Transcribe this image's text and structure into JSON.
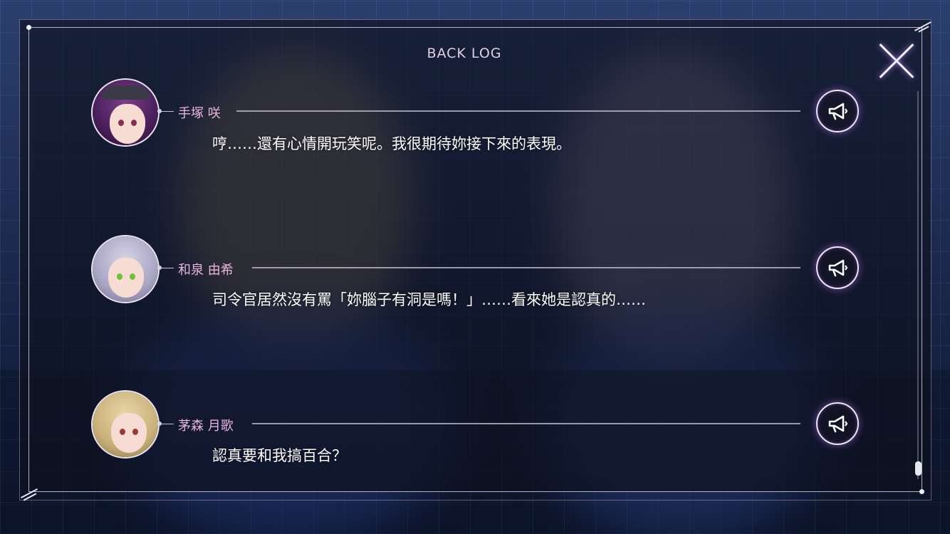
{
  "screen": {
    "title": "BACK LOG"
  },
  "colors": {
    "name_text": "#e7b5e0",
    "message_text": "#ffffff",
    "panel_bg": "#0e101e",
    "glow": "#d278ff"
  },
  "entries": [
    {
      "speaker": "手塚 咲",
      "message": "哼……還有心情開玩笑呢。我很期待妳接下來的表現。",
      "icon": "megaphone-icon"
    },
    {
      "speaker": "和泉 由希",
      "message": "司令官居然沒有罵「妳腦子有洞是嗎！」……看來她是認真的……",
      "icon": "megaphone-icon"
    },
    {
      "speaker": "茅森 月歌",
      "message": "認真要和我搞百合？",
      "icon": "megaphone-icon"
    }
  ],
  "scroll": {
    "position": 1.0
  }
}
